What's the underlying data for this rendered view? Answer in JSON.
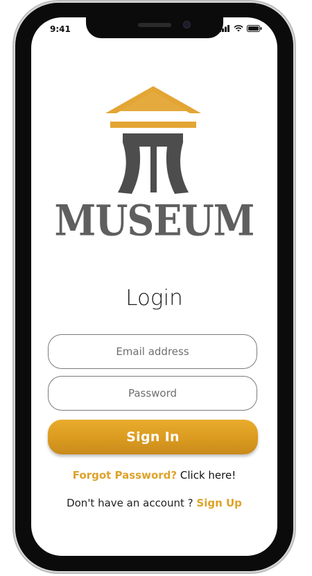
{
  "status_bar": {
    "time": "9:41",
    "icons": [
      "signal-icon",
      "wifi-icon",
      "battery-icon"
    ]
  },
  "brand": {
    "name": "MUSEUM",
    "logo_icon": "museum-logo-icon",
    "gold": "#e3a534",
    "dark": "#4a4a4a"
  },
  "login": {
    "title": "Login",
    "email_placeholder": "Email address",
    "password_placeholder": "Password",
    "sign_in_label": "Sign In",
    "forgot_prefix": "Forgot Password?",
    "forgot_link": "Click here!",
    "signup_prefix": "Don't have an account ?",
    "signup_link": "Sign Up"
  },
  "colors": {
    "accent": "#dea22a",
    "button": "#d9991f",
    "text": "#1e1e1e",
    "frame": "#0b0b0b"
  }
}
